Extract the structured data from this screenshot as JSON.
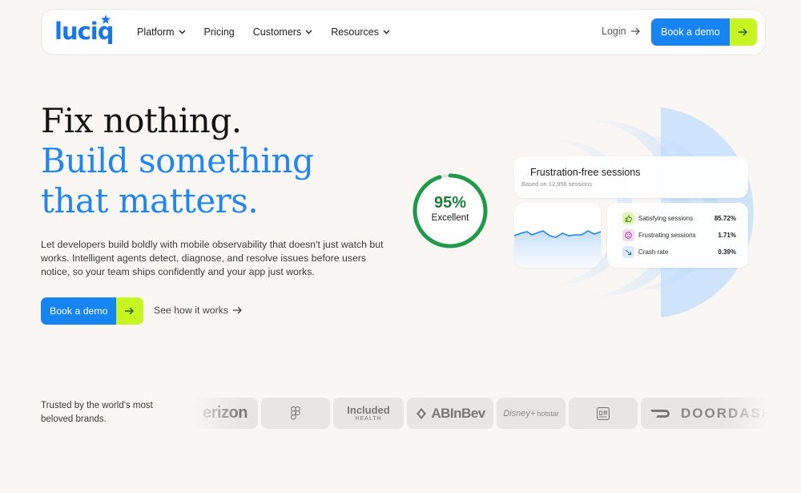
{
  "nav": {
    "logo_text": "luciq",
    "links": [
      {
        "label": "Platform",
        "has_dropdown": true
      },
      {
        "label": "Pricing",
        "has_dropdown": false
      },
      {
        "label": "Customers",
        "has_dropdown": true
      },
      {
        "label": "Resources",
        "has_dropdown": true
      }
    ],
    "login_label": "Login",
    "cta_label": "Book a demo"
  },
  "hero": {
    "line1": "Fix nothing.",
    "line2": "Build something",
    "line3": "that matters.",
    "description": "Let developers build boldly with mobile observability that doesn't just watch but works. Intelligent agents detect, diagnose, and resolve issues before users notice, so your team ships confidently and your app just works.",
    "primary_cta": "Book a demo",
    "secondary_cta": "See how it works"
  },
  "dashboard": {
    "gauge_value": "95%",
    "gauge_label": "Excellent",
    "gauge_fraction": 0.95,
    "card_title": "Frustration-free sessions",
    "card_subtitle": "Based on 12,956 sessions",
    "metrics": [
      {
        "label": "Satisfying sessions",
        "value": "85.72%",
        "icon": "thumbs-up-icon"
      },
      {
        "label": "Frustrating sessions",
        "value": "1.71%",
        "icon": "frown-face-icon"
      },
      {
        "label": "Crash rate",
        "value": "0.39%",
        "icon": "trend-down-icon"
      }
    ]
  },
  "trusted": {
    "text": "Trusted by the world's most beloved brands.",
    "brands": [
      "erizon",
      "Included",
      "HEALTH",
      "ABInBev",
      "hotstar",
      "DOORDASH"
    ]
  },
  "colors": {
    "brand_blue": "#1784f4",
    "lime": "#c6f522",
    "gauge_green": "#1e9a4a",
    "background": "#f9f6f4"
  }
}
